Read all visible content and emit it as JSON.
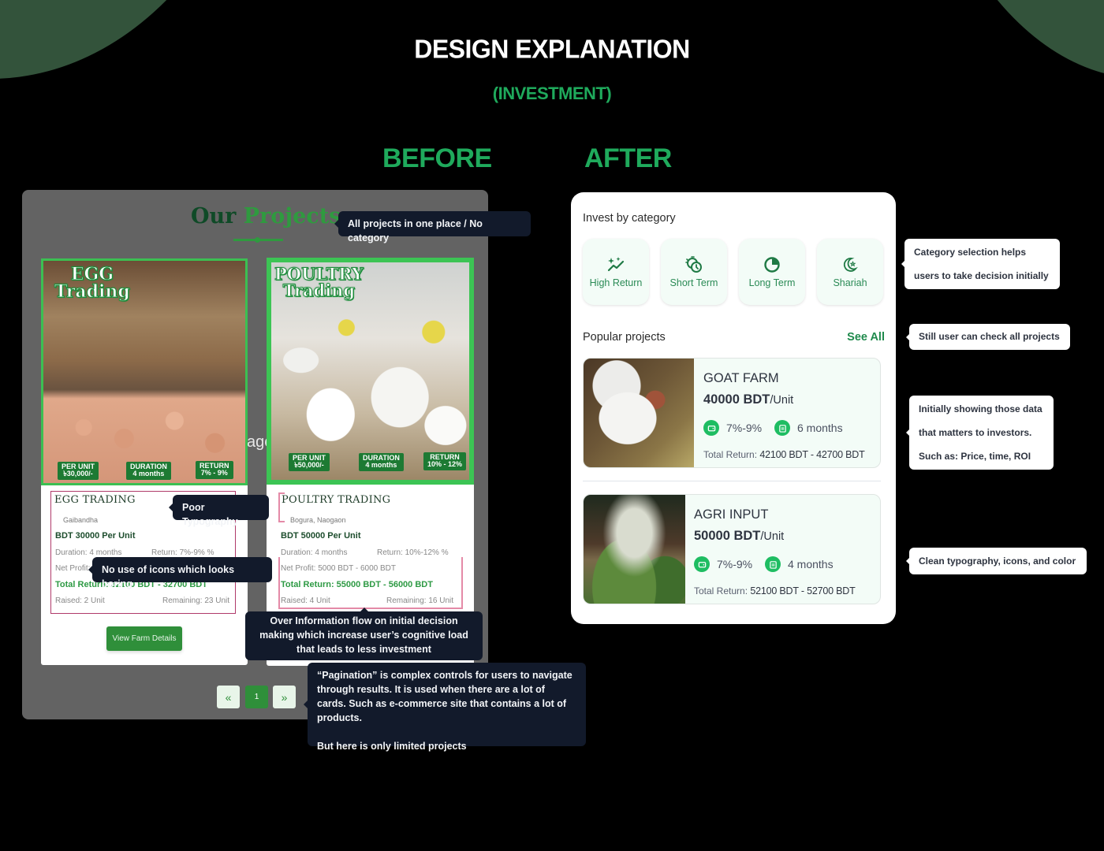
{
  "header": {
    "title": "DESIGN EXPLANATION",
    "subtitle": "(INVESTMENT)",
    "before_label": "BEFORE",
    "after_label": "AFTER"
  },
  "before": {
    "heading_word1": "Our",
    "heading_word2": "Projects",
    "stray_text": "age",
    "cards": [
      {
        "image_title_line1": "EGG",
        "image_title_line2": "Trading",
        "badges": [
          {
            "label": "PER UNIT",
            "value": "৳30,000/-"
          },
          {
            "label": "DURATION",
            "value": "4 months"
          },
          {
            "label": "RETURN",
            "value": "7% - 9%"
          }
        ],
        "name": "EGG TRADING",
        "location": "Gaibandha",
        "price": "BDT 30000 Per Unit",
        "duration": "Duration: 4 months",
        "return": "Return: 7%-9% %",
        "net_profit": "Net Profit: 2100 BDT - 2700 BDT",
        "total_return": "Total Return: 32100 BDT - 32700 BDT",
        "raised": "Raised: 2 Unit",
        "remaining": "Remaining: 23 Unit",
        "button": "View Farm Details"
      },
      {
        "image_title_line1": "POULTRY",
        "image_title_line2": "Trading",
        "badges": [
          {
            "label": "PER UNIT",
            "value": "৳50,000/-"
          },
          {
            "label": "DURATION",
            "value": "4 months"
          },
          {
            "label": "RETURN",
            "value": "10% - 12%"
          }
        ],
        "name": "POULTRY TRADING",
        "location": "Bogura, Naogaon",
        "price": "BDT 50000 Per Unit",
        "duration": "Duration: 4 months",
        "return": "Return: 10%-12% %",
        "net_profit": "Net Profit: 5000 BDT - 6000 BDT",
        "total_return": "Total Return: 55000 BDT - 56000 BDT",
        "raised": "Raised: 4 Unit",
        "remaining": "Remaining: 16 Unit"
      }
    ],
    "pagination": {
      "prev": "«",
      "current": "1",
      "next": "»"
    },
    "annotations": {
      "no_category": "All projects in one place / No category",
      "typography": "Poor Typography",
      "icons": "No use of icons which looks boring",
      "overload": "Over Information flow on initial decision making which increase user’s cognitive load that leads to less investment",
      "pagination_line1": "“Pagination” is complex controls for users to navigate through results. It is used when there are a lot of cards. Such as e-commerce site that contains a lot of products.",
      "pagination_line2": "But here is only limited projects"
    }
  },
  "after": {
    "category_heading": "Invest by category",
    "categories": [
      {
        "label": "High Return",
        "icon": "trend-sparkle-icon"
      },
      {
        "label": "Short Term",
        "icon": "timer-icon"
      },
      {
        "label": "Long Term",
        "icon": "pie-clock-icon"
      },
      {
        "label": "Shariah",
        "icon": "crescent-star-icon"
      }
    ],
    "popular_heading": "Popular projects",
    "see_all": "See All",
    "projects": [
      {
        "name": "GOAT FARM",
        "price": "40000 BDT",
        "unit": "/Unit",
        "return_range": "7%-9%",
        "duration": "6 months",
        "total_label": "Total Return:",
        "total_value": "42100 BDT - 42700 BDT"
      },
      {
        "name": "AGRI INPUT",
        "price": "50000 BDT",
        "unit": "/Unit",
        "return_range": "7%-9%",
        "duration": "4 months",
        "total_label": "Total Return:",
        "total_value": "52100 BDT - 52700 BDT"
      }
    ],
    "annotations": {
      "category_line1": "Category selection helps",
      "category_line2": "users to take decision initially",
      "see_all": "Still user can check all projects",
      "data_line1": "Initially showing those data",
      "data_line2": "that matters to investors.",
      "data_line3": "Such as: Price, time, ROI",
      "clean": "Clean typography, icons, and color"
    }
  },
  "colors": {
    "accent_green": "#1faa5c",
    "blob_green": "#33533b",
    "tooltip_dark": "#121a2b",
    "old_button_green": "#2f8f3a"
  }
}
